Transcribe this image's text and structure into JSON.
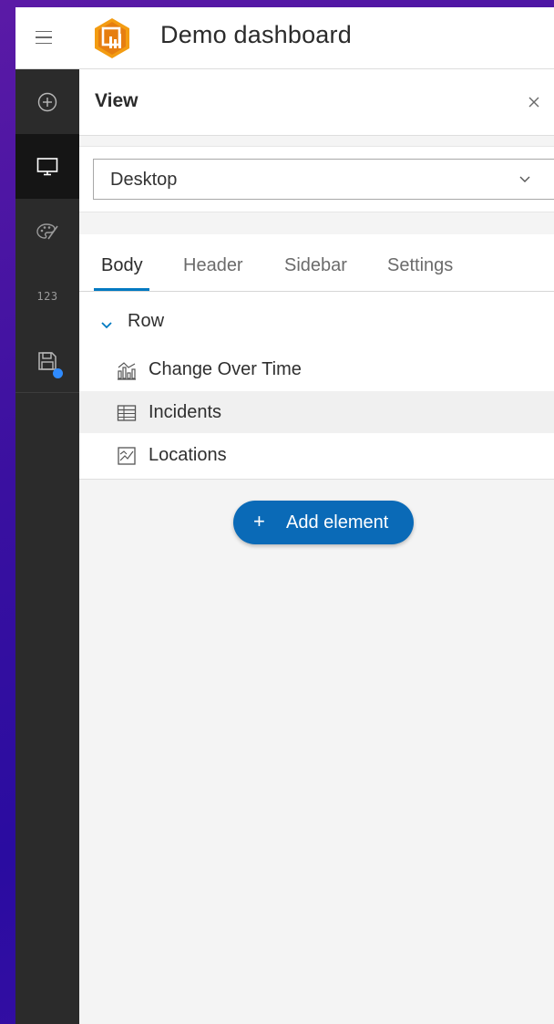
{
  "app": {
    "title": "Demo dashboard",
    "brand_color": "#f39c12"
  },
  "rail": {
    "items": [
      {
        "icon": "add-circle-icon",
        "active": false
      },
      {
        "icon": "monitor-icon",
        "active": true
      },
      {
        "icon": "palette-icon",
        "active": false
      },
      {
        "icon": "numbers-icon",
        "active": false,
        "text": "123"
      },
      {
        "icon": "save-icon",
        "active": false,
        "badge": true
      }
    ],
    "numbers_text": "123",
    "badge_color": "#2f8bff"
  },
  "panel": {
    "title": "View",
    "close_icon": "close-icon",
    "view_select": {
      "value": "Desktop",
      "icon": "chevron-down-icon"
    },
    "tabs": [
      {
        "label": "Body",
        "active": true
      },
      {
        "label": "Header",
        "active": false
      },
      {
        "label": "Sidebar",
        "active": false
      },
      {
        "label": "Settings",
        "active": false
      }
    ],
    "tree": {
      "group_label": "Row",
      "items": [
        {
          "label": "Change Over Time",
          "icon": "chart-icon"
        },
        {
          "label": "Incidents",
          "icon": "table-icon",
          "highlighted": true
        },
        {
          "label": "Locations",
          "icon": "map-icon"
        }
      ]
    },
    "add_button": {
      "plus": "+",
      "label": "Add element"
    }
  },
  "colors": {
    "accent": "#0079c1",
    "button": "#0a6ab7",
    "rail_bg": "#2b2b2b"
  }
}
